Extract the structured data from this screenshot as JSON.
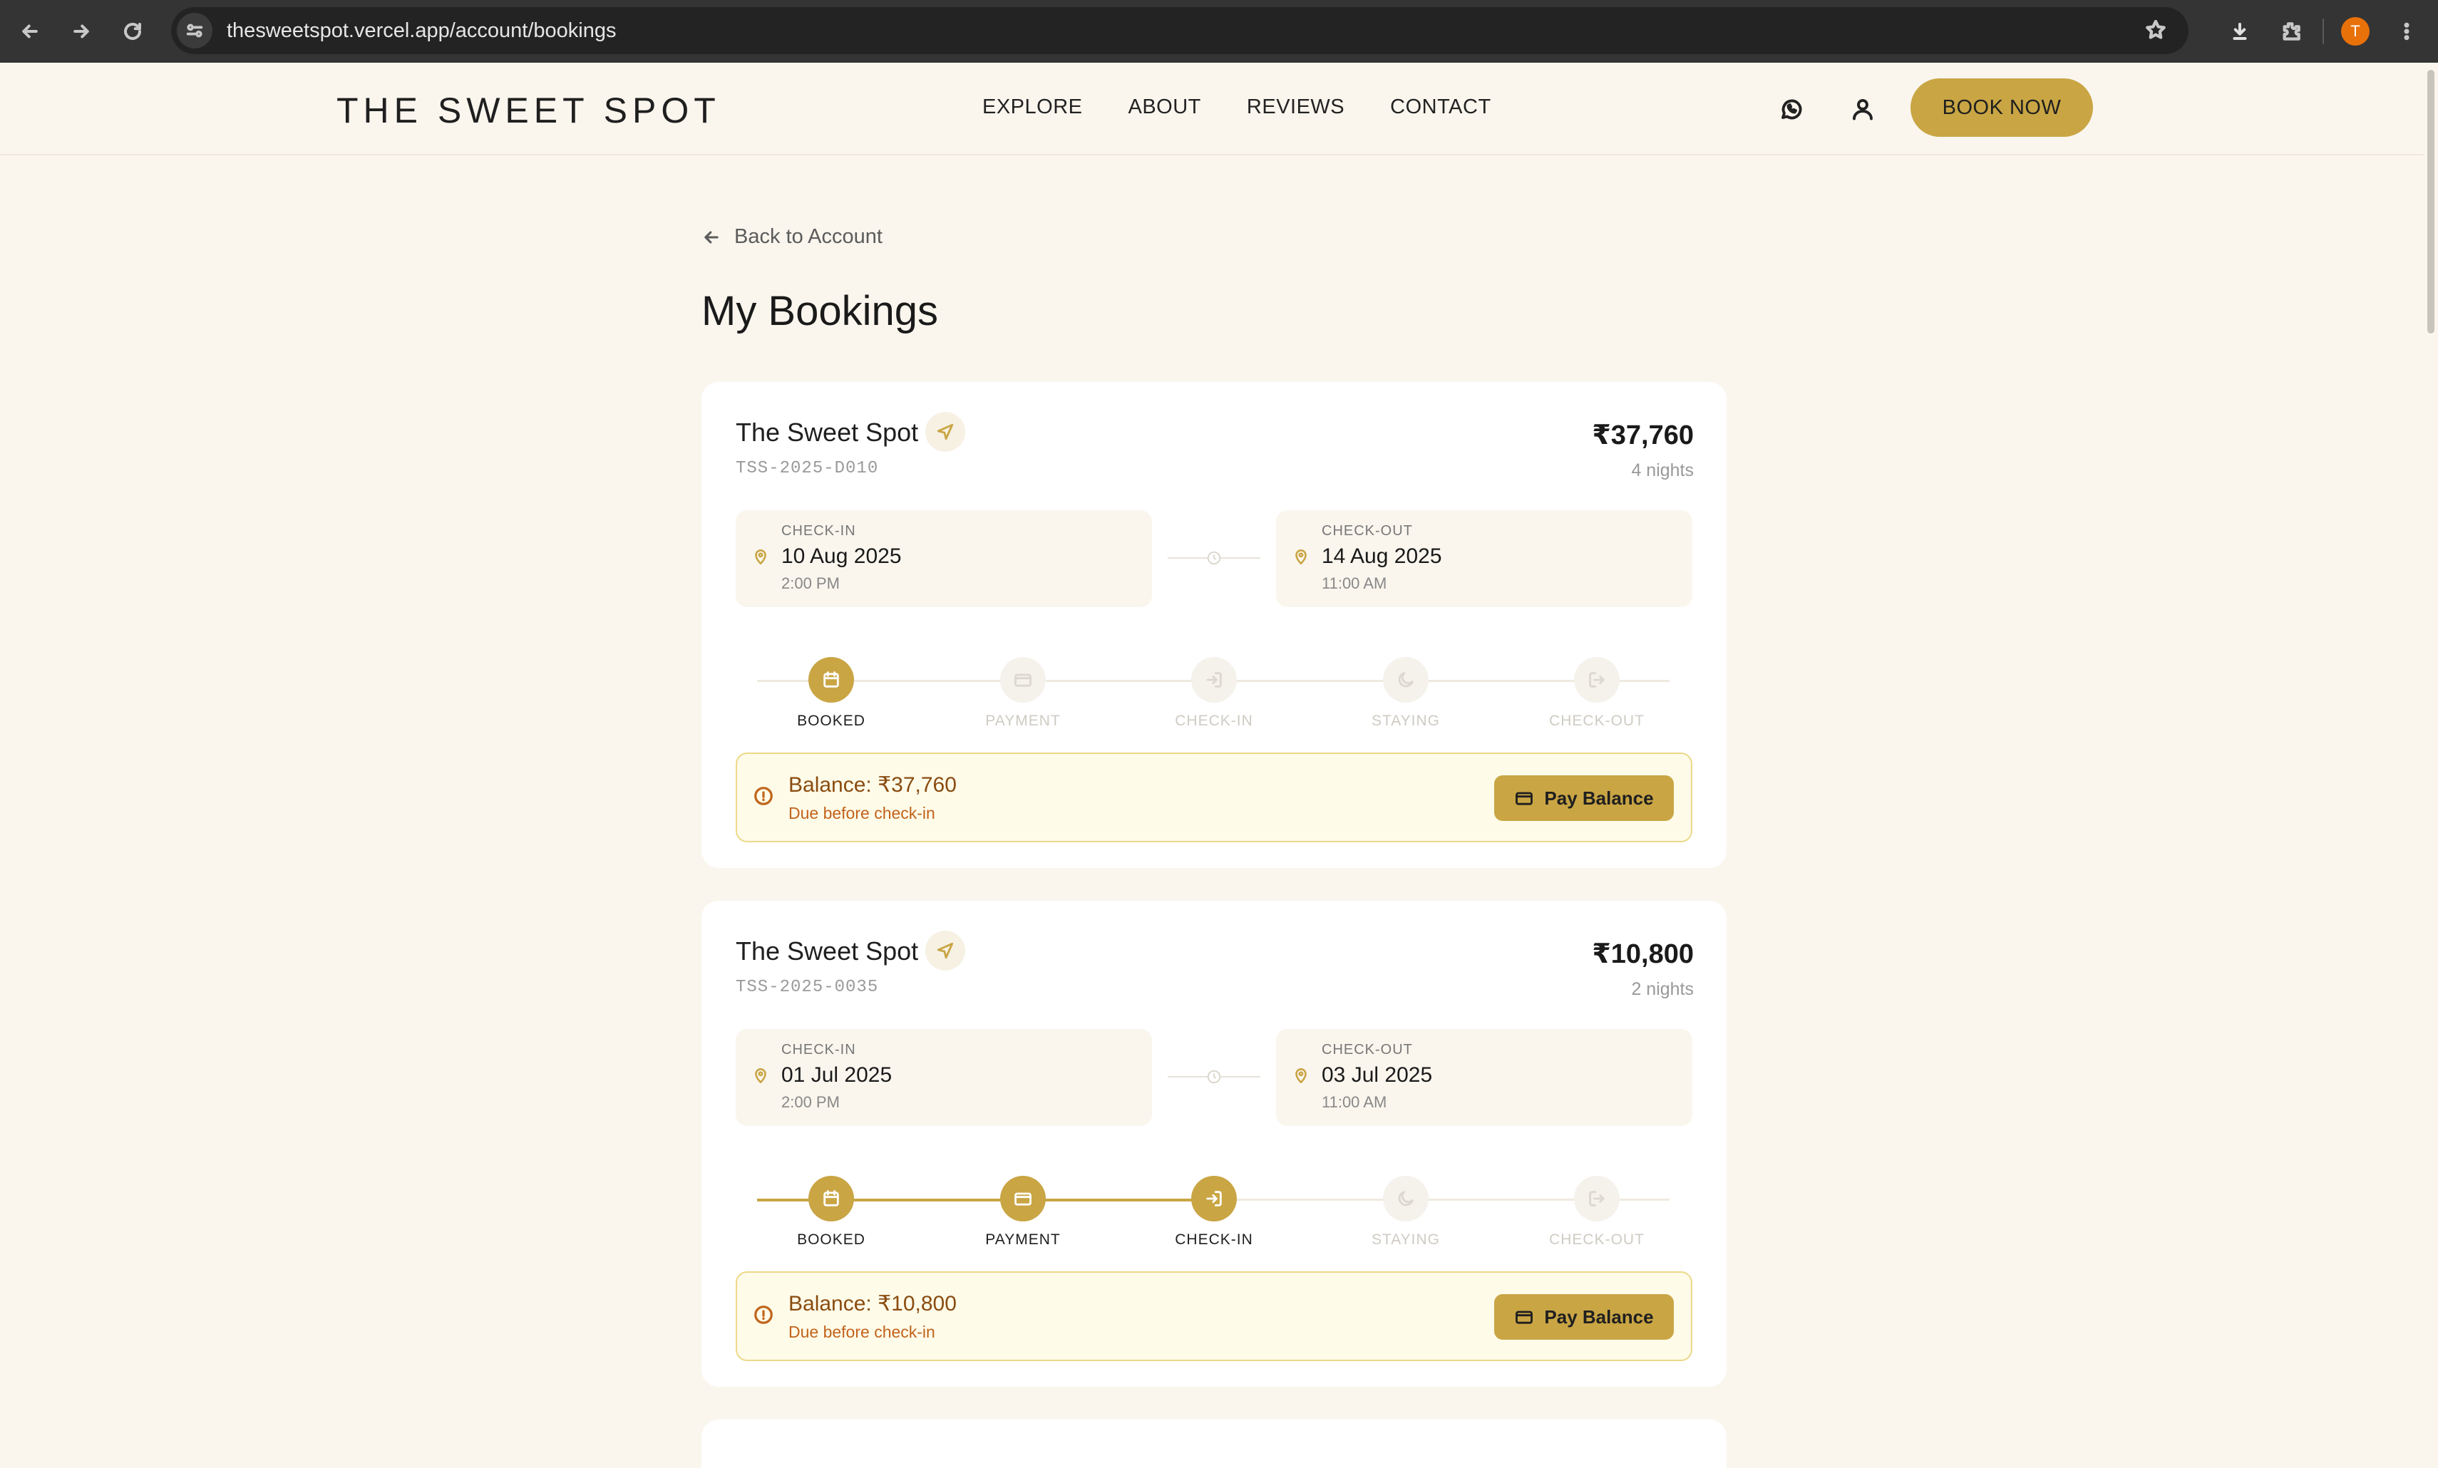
{
  "browser": {
    "url": "thesweetspot.vercel.app/account/bookings",
    "profile_initial": "T"
  },
  "header": {
    "logo": "THE SWEET SPOT",
    "nav": [
      "EXPLORE",
      "ABOUT",
      "REVIEWS",
      "CONTACT"
    ],
    "book_now": "BOOK NOW"
  },
  "page": {
    "back_label": "Back to Account",
    "title": "My Bookings"
  },
  "bookings": [
    {
      "property": "The Sweet Spot",
      "ref": "TSS-2025-D010",
      "total": "₹37,760",
      "nights": "4 nights",
      "checkin": {
        "label": "CHECK-IN",
        "date": "10 Aug 2025",
        "time": "2:00 PM"
      },
      "checkout": {
        "label": "CHECK-OUT",
        "date": "14 Aug 2025",
        "time": "11:00 AM"
      },
      "steps": [
        "BOOKED",
        "PAYMENT",
        "CHECK-IN",
        "STAYING",
        "CHECK-OUT"
      ],
      "completed_steps": 1,
      "balance": "Balance: ₹37,760",
      "due_note": "Due before check-in",
      "pay_label": "Pay Balance"
    },
    {
      "property": "The Sweet Spot",
      "ref": "TSS-2025-0035",
      "total": "₹10,800",
      "nights": "2 nights",
      "checkin": {
        "label": "CHECK-IN",
        "date": "01 Jul 2025",
        "time": "2:00 PM"
      },
      "checkout": {
        "label": "CHECK-OUT",
        "date": "03 Jul 2025",
        "time": "11:00 AM"
      },
      "steps": [
        "BOOKED",
        "PAYMENT",
        "CHECK-IN",
        "STAYING",
        "CHECK-OUT"
      ],
      "completed_steps": 3,
      "balance": "Balance: ₹10,800",
      "due_note": "Due before check-in",
      "pay_label": "Pay Balance"
    }
  ],
  "colors": {
    "accent": "#c9a544",
    "page_bg": "#faf6ee",
    "warning_text": "#8a4c10"
  }
}
